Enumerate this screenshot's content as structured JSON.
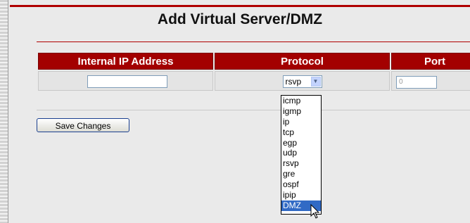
{
  "page": {
    "title": "Add Virtual Server/DMZ"
  },
  "table": {
    "headers": [
      "Internal IP Address",
      "Protocol",
      "Port"
    ],
    "ip_value": "",
    "protocol_value": "rsvp",
    "port_placeholder": "0"
  },
  "protocol_options": [
    "icmp",
    "igmp",
    "ip",
    "tcp",
    "egp",
    "udp",
    "rsvp",
    "gre",
    "ospf",
    "ipip",
    "DMZ"
  ],
  "highlighted_option": "DMZ",
  "buttons": {
    "save_label": "Save Changes"
  },
  "colors": {
    "header_bg": "#a30000",
    "accent_rule": "#b00000",
    "selection": "#316ac5"
  },
  "icons": {
    "select_arrow": "chevron-down-icon",
    "cursor": "mouse-pointer-icon"
  }
}
